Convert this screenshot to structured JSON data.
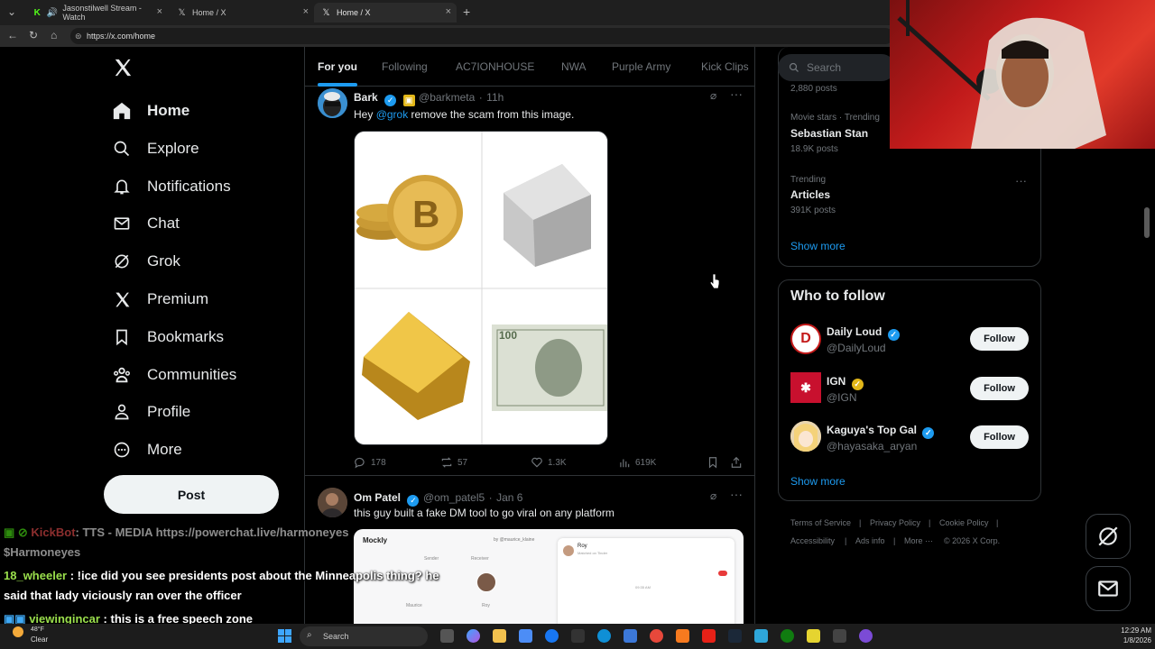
{
  "browser": {
    "tabs": [
      {
        "label": "Jasonstilwell Stream - Watch"
      },
      {
        "label": "Home / X"
      },
      {
        "label": "Home / X"
      }
    ],
    "url": "https://x.com/home"
  },
  "nav": {
    "items": [
      {
        "label": "Home",
        "icon": "home-icon"
      },
      {
        "label": "Explore",
        "icon": "search-icon"
      },
      {
        "label": "Notifications",
        "icon": "bell-icon"
      },
      {
        "label": "Chat",
        "icon": "mail-icon"
      },
      {
        "label": "Grok",
        "icon": "grok-icon"
      },
      {
        "label": "Premium",
        "icon": "x-logo-icon"
      },
      {
        "label": "Bookmarks",
        "icon": "bookmark-icon"
      },
      {
        "label": "Communities",
        "icon": "people-icon"
      },
      {
        "label": "Profile",
        "icon": "person-icon"
      },
      {
        "label": "More",
        "icon": "more-circle-icon"
      }
    ],
    "post_label": "Post"
  },
  "feed": {
    "tabs": [
      "For you",
      "Following",
      "AC7IONHOUSE",
      "NWA",
      "Purple Army",
      "Kick Clips"
    ],
    "tweets": [
      {
        "name": "Bark",
        "handle": "@barkmeta",
        "time": "11h",
        "text_prefix": "Hey ",
        "mention": "@grok",
        "text_suffix": " remove the scam from this image.",
        "replies": "178",
        "reposts": "57",
        "likes": "1.3K",
        "views": "619K"
      },
      {
        "name": "Om Patel",
        "handle": "@om_patel5",
        "time": "Jan 6",
        "text": "this guy built a fake DM tool to go viral on any platform",
        "media_app": "Mockly",
        "media_contact": "Roy",
        "media_sub": "Matched on Tinder",
        "media_time": "09:35 AM",
        "media_sender": "Sender",
        "media_receiver": "Receiver",
        "media_by": "by @maurice_klaine",
        "media_maurice": "Maurice",
        "media_roy": "Roy"
      }
    ]
  },
  "right": {
    "search_placeholder": "Search",
    "trends": [
      {
        "count_top": "2,880 posts"
      },
      {
        "category": "Movie stars · Trending",
        "title": "Sebastian Stan",
        "count": "18.9K posts"
      },
      {
        "category": "Trending",
        "title": "Articles",
        "count": "391K posts"
      }
    ],
    "show_more": "Show more",
    "who_to_follow": "Who to follow",
    "accounts": [
      {
        "name": "Daily Loud",
        "handle": "@DailyLoud",
        "button": "Follow"
      },
      {
        "name": "IGN",
        "handle": "@IGN",
        "button": "Follow"
      },
      {
        "name": "Kaguya's Top Gal",
        "handle": "@hayasaka_aryan",
        "button": "Follow"
      }
    ],
    "show_more_2": "Show more",
    "footer": [
      "Terms of Service",
      "|",
      "Privacy Policy",
      "|",
      "Cookie Policy",
      "|",
      "Accessibility",
      "|",
      "Ads info",
      "|",
      "More ···",
      "© 2026 X Corp."
    ]
  },
  "chat": [
    {
      "user": "KickBot",
      "text": ": TTS - MEDIA https://powerchat.live/harmoneyes"
    },
    {
      "user": "",
      "text": "$Harmoneyes"
    },
    {
      "user": "18_wheeler",
      "text": " : !ice did you see presidents post about the Minneapolis thing? he"
    },
    {
      "user": "",
      "text": "said that lady viciously ran over the officer"
    },
    {
      "user": "viewingincar",
      "text": " : this is a free speech zone"
    }
  ],
  "taskbar": {
    "weather_temp": "48°F",
    "weather_desc": "Clear",
    "search": "Search",
    "time": "12:29 AM",
    "date": "1/8/2026"
  }
}
